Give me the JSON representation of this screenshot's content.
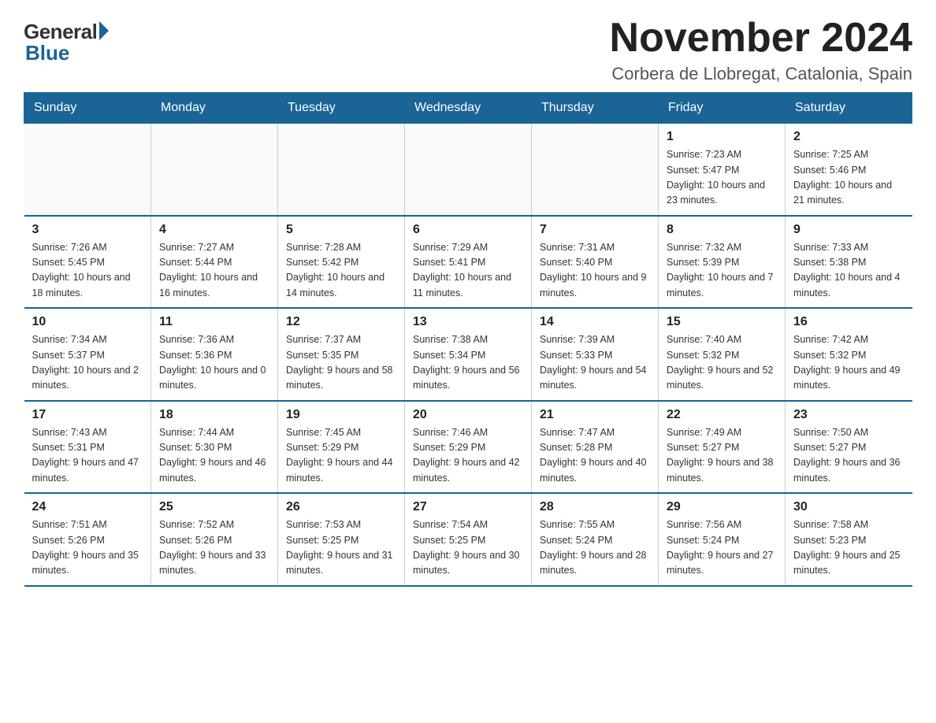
{
  "header": {
    "logo_general": "General",
    "logo_blue": "Blue",
    "month_title": "November 2024",
    "location": "Corbera de Llobregat, Catalonia, Spain"
  },
  "weekdays": [
    "Sunday",
    "Monday",
    "Tuesday",
    "Wednesday",
    "Thursday",
    "Friday",
    "Saturday"
  ],
  "weeks": [
    [
      {
        "day": "",
        "info": ""
      },
      {
        "day": "",
        "info": ""
      },
      {
        "day": "",
        "info": ""
      },
      {
        "day": "",
        "info": ""
      },
      {
        "day": "",
        "info": ""
      },
      {
        "day": "1",
        "info": "Sunrise: 7:23 AM\nSunset: 5:47 PM\nDaylight: 10 hours and 23 minutes."
      },
      {
        "day": "2",
        "info": "Sunrise: 7:25 AM\nSunset: 5:46 PM\nDaylight: 10 hours and 21 minutes."
      }
    ],
    [
      {
        "day": "3",
        "info": "Sunrise: 7:26 AM\nSunset: 5:45 PM\nDaylight: 10 hours and 18 minutes."
      },
      {
        "day": "4",
        "info": "Sunrise: 7:27 AM\nSunset: 5:44 PM\nDaylight: 10 hours and 16 minutes."
      },
      {
        "day": "5",
        "info": "Sunrise: 7:28 AM\nSunset: 5:42 PM\nDaylight: 10 hours and 14 minutes."
      },
      {
        "day": "6",
        "info": "Sunrise: 7:29 AM\nSunset: 5:41 PM\nDaylight: 10 hours and 11 minutes."
      },
      {
        "day": "7",
        "info": "Sunrise: 7:31 AM\nSunset: 5:40 PM\nDaylight: 10 hours and 9 minutes."
      },
      {
        "day": "8",
        "info": "Sunrise: 7:32 AM\nSunset: 5:39 PM\nDaylight: 10 hours and 7 minutes."
      },
      {
        "day": "9",
        "info": "Sunrise: 7:33 AM\nSunset: 5:38 PM\nDaylight: 10 hours and 4 minutes."
      }
    ],
    [
      {
        "day": "10",
        "info": "Sunrise: 7:34 AM\nSunset: 5:37 PM\nDaylight: 10 hours and 2 minutes."
      },
      {
        "day": "11",
        "info": "Sunrise: 7:36 AM\nSunset: 5:36 PM\nDaylight: 10 hours and 0 minutes."
      },
      {
        "day": "12",
        "info": "Sunrise: 7:37 AM\nSunset: 5:35 PM\nDaylight: 9 hours and 58 minutes."
      },
      {
        "day": "13",
        "info": "Sunrise: 7:38 AM\nSunset: 5:34 PM\nDaylight: 9 hours and 56 minutes."
      },
      {
        "day": "14",
        "info": "Sunrise: 7:39 AM\nSunset: 5:33 PM\nDaylight: 9 hours and 54 minutes."
      },
      {
        "day": "15",
        "info": "Sunrise: 7:40 AM\nSunset: 5:32 PM\nDaylight: 9 hours and 52 minutes."
      },
      {
        "day": "16",
        "info": "Sunrise: 7:42 AM\nSunset: 5:32 PM\nDaylight: 9 hours and 49 minutes."
      }
    ],
    [
      {
        "day": "17",
        "info": "Sunrise: 7:43 AM\nSunset: 5:31 PM\nDaylight: 9 hours and 47 minutes."
      },
      {
        "day": "18",
        "info": "Sunrise: 7:44 AM\nSunset: 5:30 PM\nDaylight: 9 hours and 46 minutes."
      },
      {
        "day": "19",
        "info": "Sunrise: 7:45 AM\nSunset: 5:29 PM\nDaylight: 9 hours and 44 minutes."
      },
      {
        "day": "20",
        "info": "Sunrise: 7:46 AM\nSunset: 5:29 PM\nDaylight: 9 hours and 42 minutes."
      },
      {
        "day": "21",
        "info": "Sunrise: 7:47 AM\nSunset: 5:28 PM\nDaylight: 9 hours and 40 minutes."
      },
      {
        "day": "22",
        "info": "Sunrise: 7:49 AM\nSunset: 5:27 PM\nDaylight: 9 hours and 38 minutes."
      },
      {
        "day": "23",
        "info": "Sunrise: 7:50 AM\nSunset: 5:27 PM\nDaylight: 9 hours and 36 minutes."
      }
    ],
    [
      {
        "day": "24",
        "info": "Sunrise: 7:51 AM\nSunset: 5:26 PM\nDaylight: 9 hours and 35 minutes."
      },
      {
        "day": "25",
        "info": "Sunrise: 7:52 AM\nSunset: 5:26 PM\nDaylight: 9 hours and 33 minutes."
      },
      {
        "day": "26",
        "info": "Sunrise: 7:53 AM\nSunset: 5:25 PM\nDaylight: 9 hours and 31 minutes."
      },
      {
        "day": "27",
        "info": "Sunrise: 7:54 AM\nSunset: 5:25 PM\nDaylight: 9 hours and 30 minutes."
      },
      {
        "day": "28",
        "info": "Sunrise: 7:55 AM\nSunset: 5:24 PM\nDaylight: 9 hours and 28 minutes."
      },
      {
        "day": "29",
        "info": "Sunrise: 7:56 AM\nSunset: 5:24 PM\nDaylight: 9 hours and 27 minutes."
      },
      {
        "day": "30",
        "info": "Sunrise: 7:58 AM\nSunset: 5:23 PM\nDaylight: 9 hours and 25 minutes."
      }
    ]
  ]
}
